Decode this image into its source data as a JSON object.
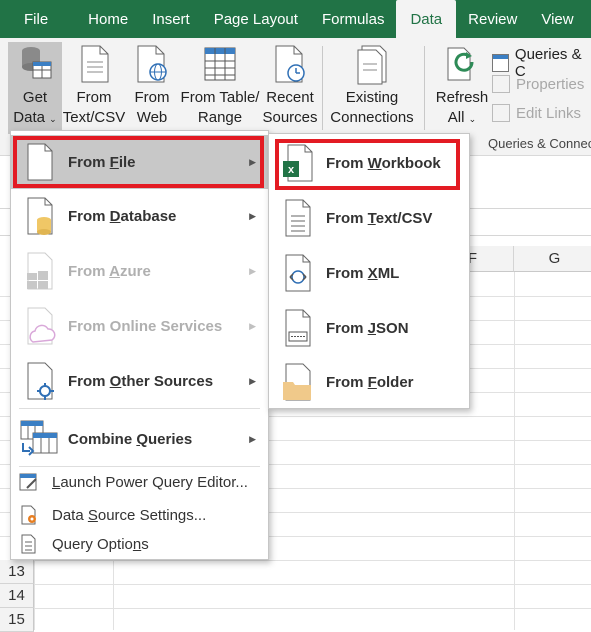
{
  "tabs": [
    "File",
    "Home",
    "Insert",
    "Page Layout",
    "Formulas",
    "Data",
    "Review",
    "View"
  ],
  "active_tab": "Data",
  "ribbon": {
    "get_data": {
      "line1": "Get",
      "line2": "Data"
    },
    "from_text_csv": {
      "line1": "From",
      "line2": "Text/CSV"
    },
    "from_web": {
      "line1": "From",
      "line2": "Web"
    },
    "from_table_range": {
      "line1": "From Table/",
      "line2": "Range"
    },
    "recent_sources": {
      "line1": "Recent",
      "line2": "Sources"
    },
    "existing_connections": {
      "line1": "Existing",
      "line2": "Connections"
    },
    "refresh_all": {
      "line1": "Refresh",
      "line2": "All"
    },
    "queries_connections": "Queries & C",
    "properties": "Properties",
    "edit_links": "Edit Links",
    "group_label": "Queries & Connec"
  },
  "grid": {
    "columns": [
      "F",
      "G"
    ],
    "rows": [
      "13",
      "14",
      "15"
    ]
  },
  "menu": {
    "items": [
      {
        "label_pre": "From ",
        "label_ul": "F",
        "label_post": "ile",
        "enabled": true,
        "highlighted": true,
        "icon": "file-icon"
      },
      {
        "label_pre": "From ",
        "label_ul": "D",
        "label_post": "atabase",
        "enabled": true,
        "icon": "database-icon"
      },
      {
        "label_pre": "From ",
        "label_ul": "A",
        "label_post": "zure",
        "enabled": false,
        "icon": "azure-icon"
      },
      {
        "label_pre": "From Online Services",
        "label_ul": "",
        "label_post": "",
        "enabled": false,
        "icon": "cloud-icon"
      },
      {
        "label_pre": "From ",
        "label_ul": "O",
        "label_post": "ther Sources",
        "enabled": true,
        "icon": "other-sources-icon"
      },
      {
        "label_pre": "Combine ",
        "label_ul": "Q",
        "label_post": "ueries",
        "enabled": true,
        "icon": "combine-queries-icon"
      }
    ],
    "small_items": [
      {
        "label_pre": "",
        "label_ul": "L",
        "label_post": "aunch Power Query Editor...",
        "icon": "power-query-icon"
      },
      {
        "label_pre": "Data ",
        "label_ul": "S",
        "label_post": "ource Settings...",
        "icon": "data-source-settings-icon"
      },
      {
        "label_pre": "Query Optio",
        "label_ul": "n",
        "label_post": "s",
        "icon": "query-options-icon"
      }
    ]
  },
  "submenu": {
    "items": [
      {
        "label_pre": "From ",
        "label_ul": "W",
        "label_post": "orkbook",
        "icon": "excel-workbook-icon",
        "highlighted": true
      },
      {
        "label_pre": "From ",
        "label_ul": "T",
        "label_post": "ext/CSV",
        "icon": "text-file-icon"
      },
      {
        "label_pre": "From ",
        "label_ul": "X",
        "label_post": "ML",
        "icon": "xml-file-icon"
      },
      {
        "label_pre": "From ",
        "label_ul": "J",
        "label_post": "SON",
        "icon": "json-file-icon"
      },
      {
        "label_pre": "From ",
        "label_ul": "F",
        "label_post": "older",
        "icon": "folder-icon"
      }
    ]
  },
  "colors": {
    "excel_green": "#217346",
    "highlight_red": "#e31b23"
  }
}
